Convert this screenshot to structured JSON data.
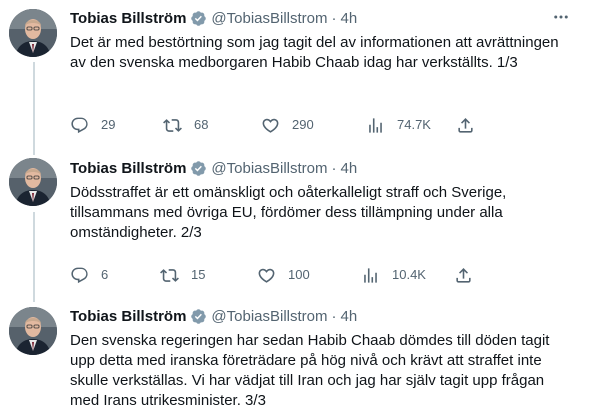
{
  "tweets": [
    {
      "name": "Tobias Billström",
      "handle": "@TobiasBillstrom",
      "dot": "·",
      "time": "4h",
      "text": "Det är med bestörtning som jag tagit del av informationen att avrättningen av den svenska medborgaren Habib Chaab idag har verkställts. 1/3",
      "replies": "29",
      "retweets": "68",
      "likes": "290",
      "views": "74.7K"
    },
    {
      "name": "Tobias Billström",
      "handle": "@TobiasBillstrom",
      "dot": "·",
      "time": "4h",
      "text": "Dödsstraffet är ett omänskligt och oåterkalleligt straff och Sverige, tillsammans med övriga EU, fördömer dess tillämpning under alla omständigheter. 2/3",
      "replies": "6",
      "retweets": "15",
      "likes": "100",
      "views": "10.4K"
    },
    {
      "name": "Tobias Billström",
      "handle": "@TobiasBillstrom",
      "dot": "·",
      "time": "4h",
      "text": "Den svenska regeringen har sedan Habib Chaab dömdes till döden tagit upp detta med iranska företrädare på hög nivå och krävt att straffet inte skulle verkställas. Vi har vädjat till Iran och jag har själv tagit upp frågan med Irans utrikesminister. 3/3"
    }
  ],
  "colors": {
    "text": "#0f1419",
    "secondary": "#536471",
    "verified": "#829aab",
    "thread_line": "#cfd9de"
  },
  "icons": [
    "verified-badge-icon",
    "more-icon",
    "reply-icon",
    "retweet-icon",
    "like-icon",
    "views-icon",
    "share-icon"
  ]
}
